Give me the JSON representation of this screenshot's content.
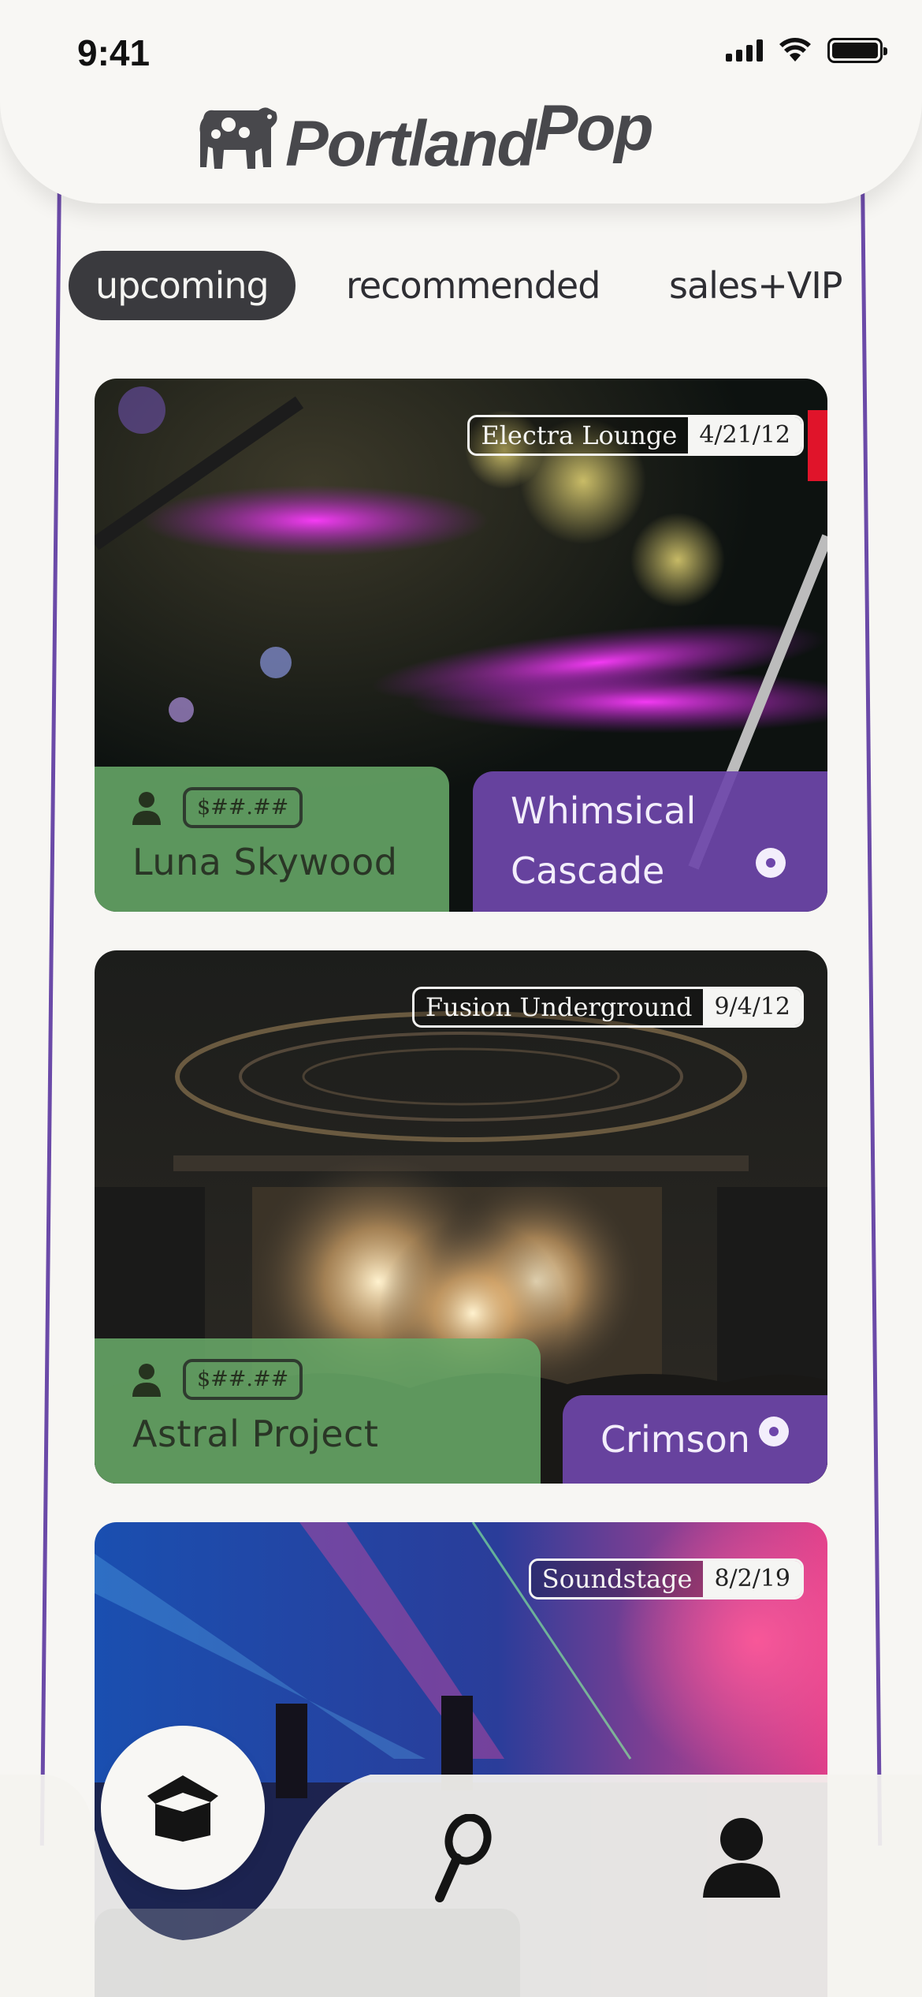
{
  "status": {
    "time": "9:41"
  },
  "brand": {
    "name_main": "Portland",
    "name_sup": "Pop"
  },
  "tabs": [
    {
      "label": "upcoming",
      "active": true
    },
    {
      "label": "recommended",
      "active": false
    },
    {
      "label": "sales+VIP",
      "active": false
    }
  ],
  "events": [
    {
      "venue": "Electra Lounge",
      "date": "4/21/12",
      "price": "$##.##",
      "artist": "Luna Skywood",
      "song_line1": "Whimsical",
      "song_line2": "Cascade"
    },
    {
      "venue": "Fusion Underground",
      "date": "9/4/12",
      "price": "$##.##",
      "artist": "Astral Project",
      "song_line1": "Crimson",
      "song_line2": ""
    },
    {
      "venue": "Soundstage",
      "date": "8/2/19",
      "price": "$##.##",
      "artist": "",
      "song_line1": "",
      "song_line2": ""
    }
  ],
  "nav": {
    "items": [
      "home-icon",
      "search-icon",
      "profile-icon"
    ]
  },
  "colors": {
    "accent_purple": "#6e46aa",
    "accent_green": "#68a868",
    "dark": "#3a3a3e",
    "background": "#f7f6f3"
  }
}
